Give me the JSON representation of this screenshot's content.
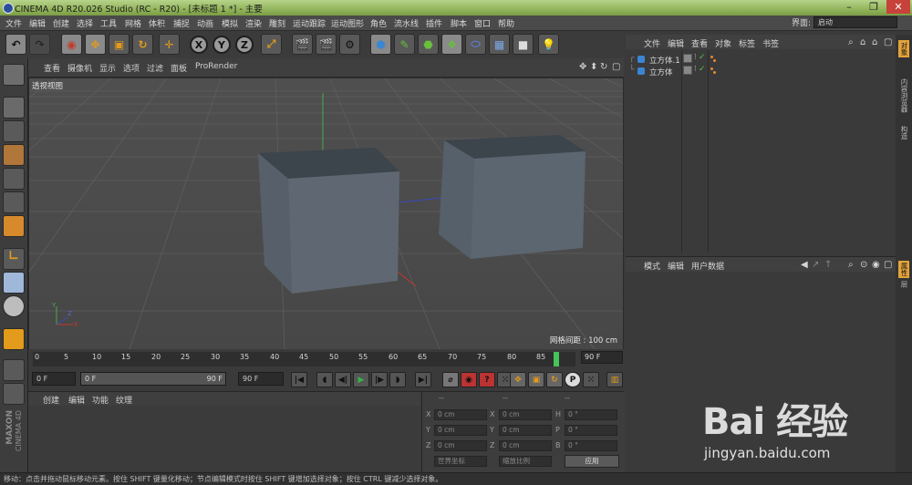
{
  "window": {
    "title": "CINEMA 4D R20.026 Studio (RC - R20) - [未标题 1 *] - 主要",
    "controls": [
      "–",
      "❐",
      "✕"
    ]
  },
  "menubar": [
    "文件",
    "编辑",
    "创建",
    "选择",
    "工具",
    "网格",
    "体积",
    "捕捉",
    "动画",
    "模拟",
    "渲染",
    "雕刻",
    "运动跟踪",
    "运动图形",
    "角色",
    "流水线",
    "插件",
    "脚本",
    "窗口",
    "帮助"
  ],
  "layout": {
    "label": "界面:",
    "value": "启动"
  },
  "viewport": {
    "menu": [
      "查看",
      "摄像机",
      "显示",
      "选项",
      "过滤",
      "面板",
      "ProRender"
    ],
    "label": "透视视图",
    "grid_info": "网格间距 : 100 cm",
    "colors": {
      "background": "#4e4e4e",
      "cube": "#5c6570",
      "grid": "#5a5a5a"
    }
  },
  "timeline": {
    "ticks": [
      "0",
      "5",
      "10",
      "15",
      "20",
      "25",
      "30",
      "35",
      "40",
      "45",
      "50",
      "55",
      "60",
      "65",
      "70",
      "75",
      "80",
      "85"
    ],
    "end_frame": "90 F",
    "current_frame_fraction": 0.97
  },
  "anim": {
    "start": "0 F",
    "range_start": "0 F",
    "range_end": "90 F",
    "end": "90 F"
  },
  "material": {
    "menu": [
      "创建",
      "编辑",
      "功能",
      "纹理"
    ]
  },
  "coordinates": {
    "headers": [
      "--",
      "--",
      "--"
    ],
    "rows": [
      {
        "a": "X",
        "av": "0 cm",
        "b": "X",
        "bv": "0 cm",
        "c": "H",
        "cv": "0 °"
      },
      {
        "a": "Y",
        "av": "0 cm",
        "b": "Y",
        "bv": "0 cm",
        "c": "P",
        "cv": "0 °"
      },
      {
        "a": "Z",
        "av": "0 cm",
        "b": "Z",
        "bv": "0 cm",
        "c": "B",
        "cv": "0 °"
      }
    ],
    "world_select": "世界坐标",
    "scale_select": "缩放比例",
    "apply": "应用"
  },
  "object_manager": {
    "menu": [
      "文件",
      "编辑",
      "查看",
      "对象",
      "标签",
      "书签"
    ],
    "objects": [
      {
        "name": "立方体.1"
      },
      {
        "name": "立方体"
      }
    ]
  },
  "attribute_manager": {
    "menu": [
      "模式",
      "编辑",
      "用户数据"
    ]
  },
  "right_tabs": [
    "对象",
    "内容浏览器",
    "构造",
    "属性",
    "层"
  ],
  "status": "移动：点击并拖动鼠标移动元素。按住 SHIFT 键量化移动；节点编辑模式时按住 SHIFT 键增加选择对象；按住 CTRL 键减少选择对象。",
  "brand": {
    "line1": "MAXON",
    "line2": "CINEMA 4D"
  },
  "watermark": {
    "text": "Bai 经验",
    "url": "jingyan.baidu.com"
  }
}
